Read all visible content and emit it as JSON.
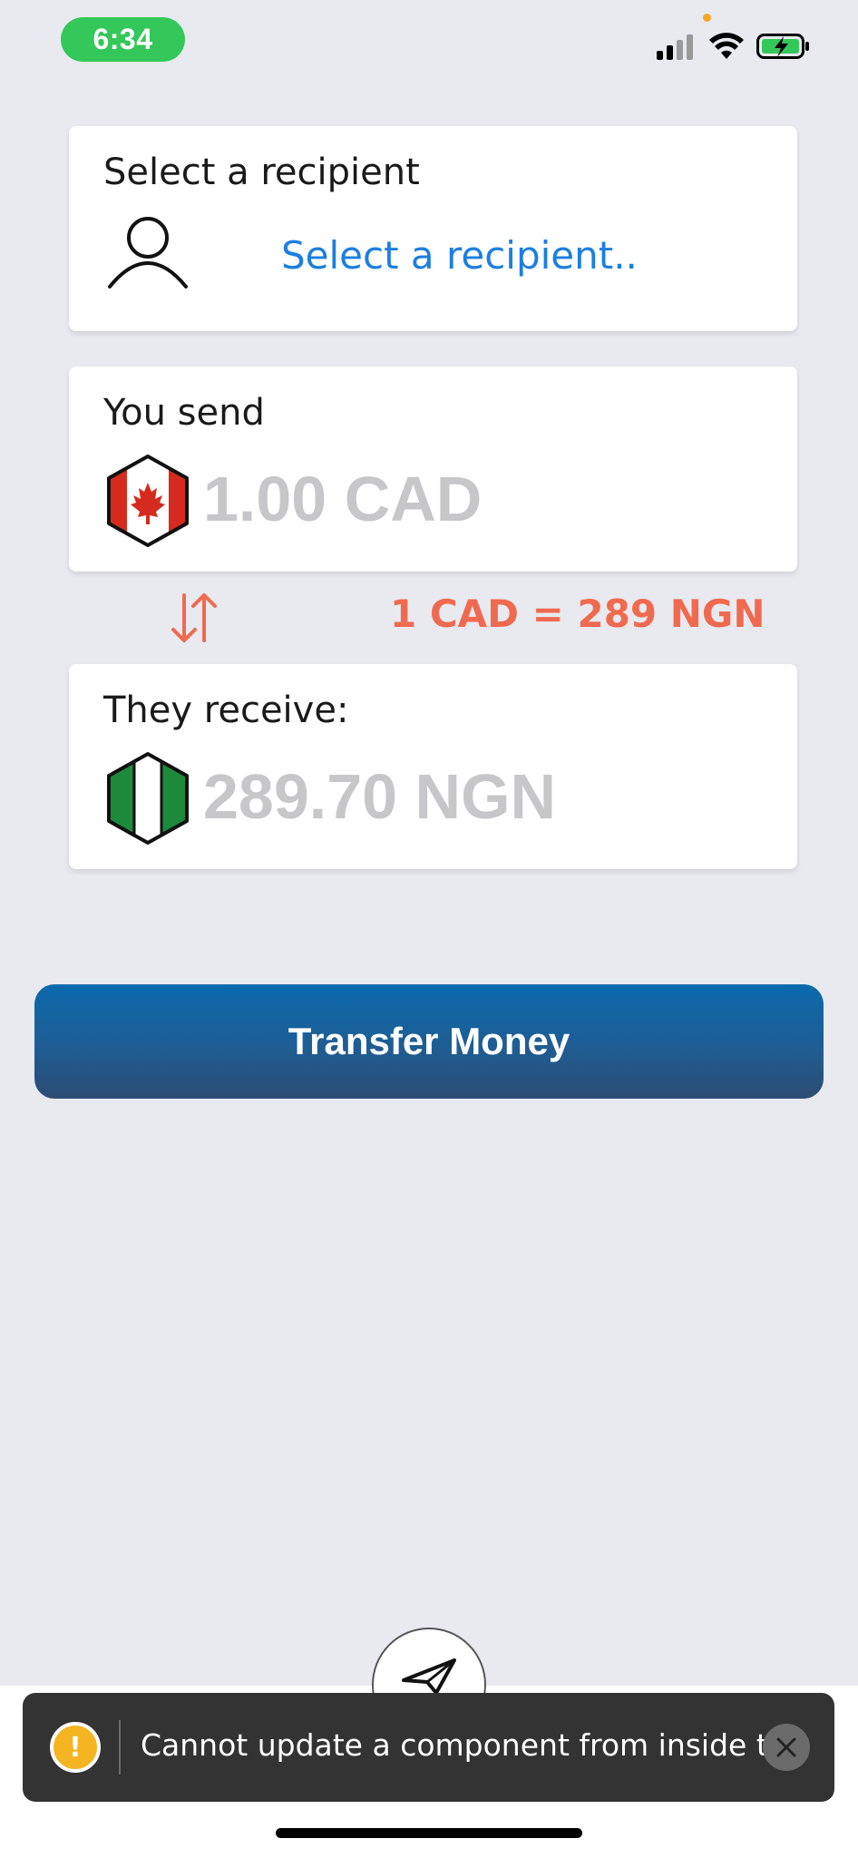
{
  "status_bar": {
    "time": "6:34",
    "icons": [
      "cellular-signal-icon",
      "wifi-icon",
      "battery-charging-icon"
    ]
  },
  "recipient": {
    "label": "Select a recipient",
    "link_text": "Select a recipient..",
    "icon": "person-icon"
  },
  "send": {
    "label": "You send",
    "placeholder": "1.00 CAD",
    "flag": "canada-flag-icon"
  },
  "rate": {
    "text": "1 CAD = 289 NGN",
    "swap_icon": "swap-arrows-icon"
  },
  "receive": {
    "label": "They receive:",
    "placeholder": "289.70 NGN",
    "flag": "nigeria-flag-icon"
  },
  "transfer_button": {
    "label": "Transfer Money"
  },
  "bottom_tab": {
    "icon": "paper-plane-icon"
  },
  "toast": {
    "message": "Cannot update a component from inside t...",
    "icon": "warning-icon",
    "warning_glyph": "!"
  },
  "colors": {
    "background": "#e8eaf0",
    "accent_link": "#1b7fe0",
    "rate": "#f06a4f",
    "button_top": "#0a6aac",
    "button_bottom": "#2c4c74",
    "status_pill": "#34c759"
  }
}
